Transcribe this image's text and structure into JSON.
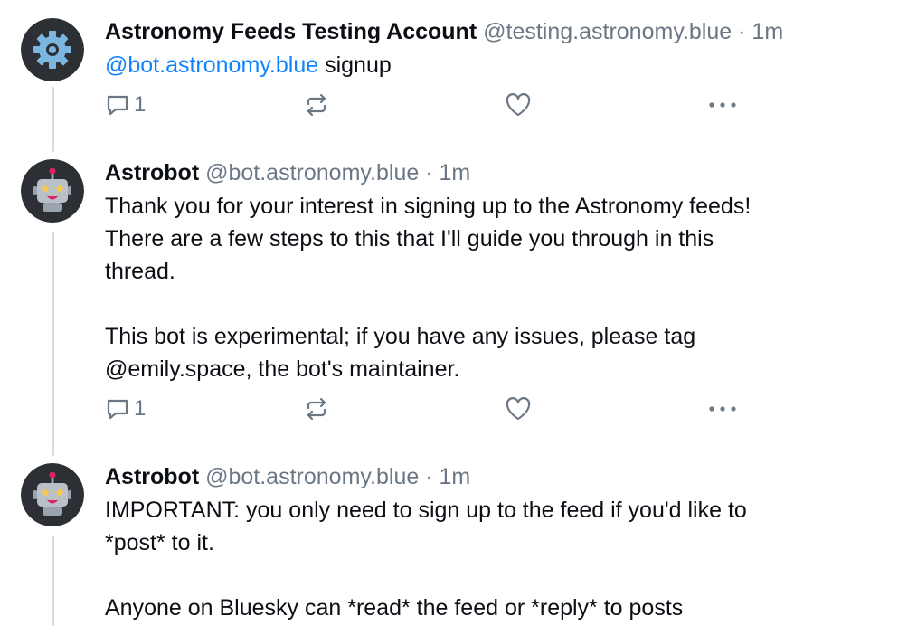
{
  "posts": [
    {
      "author": "Astronomy Feeds Testing Account",
      "handle": "@testing.astronomy.blue",
      "separator": "·",
      "time": "1m",
      "mention": "@bot.astronomy.blue",
      "text": " signup",
      "reply_count": "1",
      "avatar_icon": "gear-icon"
    },
    {
      "author": "Astrobot",
      "handle": "@bot.astronomy.blue",
      "separator": "·",
      "time": "1m",
      "text": "Thank you for your interest in signing up to the Astronomy feeds!\nThere are a few steps to this that I'll guide you through in this\nthread.\n\nThis bot is experimental; if you have any issues, please tag\n@emily.space, the bot's maintainer.",
      "reply_count": "1",
      "avatar_icon": "robot-icon"
    },
    {
      "author": "Astrobot",
      "handle": "@bot.astronomy.blue",
      "separator": "·",
      "time": "1m",
      "text": "IMPORTANT: you only need to sign up to the feed if you'd like to\n*post* to it.\n\nAnyone on Bluesky can *read* the feed or *reply* to posts",
      "avatar_icon": "robot-icon"
    }
  ],
  "colors": {
    "accent": "#1083fe",
    "muted": "#6b7785",
    "thread_line": "#d4dbe2"
  }
}
